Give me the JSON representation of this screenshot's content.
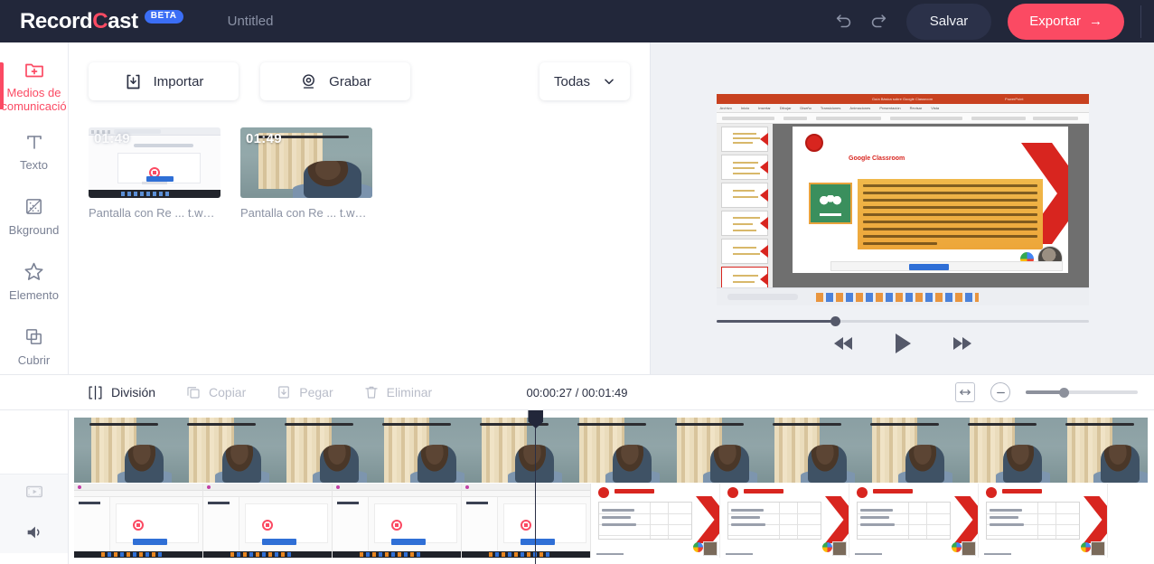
{
  "header": {
    "logo_text_pre": "Record",
    "logo_text_c": "C",
    "logo_text_post": "ast",
    "beta_label": "BETA",
    "document_title": "Untitled",
    "undo_icon": "undo-icon",
    "redo_icon": "redo-icon",
    "save_label": "Salvar",
    "export_label": "Exportar",
    "export_arrow": "→",
    "accent_color": "#fb4a63",
    "bar_color": "#22273a",
    "beta_color": "#3b6ef5"
  },
  "sidebar": {
    "items": [
      {
        "label": "Medios de comunicació",
        "icon": "folder-plus-icon",
        "active": true
      },
      {
        "label": "Texto",
        "icon": "text-t-icon",
        "active": false
      },
      {
        "label": "Bkground",
        "icon": "background-image-icon",
        "active": false
      },
      {
        "label": "Elemento",
        "icon": "star-icon",
        "active": false
      },
      {
        "label": "Cubrir",
        "icon": "overlay-layers-icon",
        "active": false
      }
    ]
  },
  "media_panel": {
    "import_label": "Importar",
    "import_icon": "download-box-icon",
    "record_label": "Grabar",
    "record_icon": "webcam-icon",
    "filter_label": "Todas",
    "filter_icon": "chevron-down-icon",
    "items": [
      {
        "duration": "01:49",
        "name": "Pantalla con Re ... t.webm",
        "kind": "screen"
      },
      {
        "duration": "01:49",
        "name": "Pantalla con Re ... t.webm",
        "kind": "camera"
      }
    ]
  },
  "preview": {
    "progress_percent": 32,
    "rewind_icon": "rewind-icon",
    "play_icon": "play-icon",
    "forward_icon": "fast-forward-icon",
    "slide": {
      "window_title": "Guía Básica sobre Google Classroom",
      "app_name": "PowerPoint",
      "ribbon_tabs": [
        "Archivo",
        "Inicio",
        "Insertar",
        "Dibujar",
        "Diseño",
        "Transiciones",
        "Animaciones",
        "Presentación con diapositivas",
        "Revisar",
        "Vista"
      ],
      "heading": "Google Classroom",
      "body": "Classroom es un servicio gratuito para escuelas, organizaciones sin fines de lucro y cualquier persona que tenga una cuenta personal de Google. Classroom permite que estudiantes y profesores se conecten fácilmente, tanto dentro como fuera de las escuelas. Classroom ahorra tiempo y papel, y facilita la creación de clases, la distribución de tareas, la comunicación y la organización.",
      "button_label": "Dejar de compartir"
    }
  },
  "timeline": {
    "actions": [
      {
        "label": "División",
        "icon": "split-icon",
        "enabled": true
      },
      {
        "label": "Copiar",
        "icon": "copy-icon",
        "enabled": false
      },
      {
        "label": "Pegar",
        "icon": "paste-icon",
        "enabled": false
      },
      {
        "label": "Eliminar",
        "icon": "trash-icon",
        "enabled": false
      }
    ],
    "current_time": "00:00:27",
    "total_time": "00:01:49",
    "time_display": "00:00:27 / 00:01:49",
    "fit_icon": "fit-to-width-icon",
    "zoom_out_icon": "zoom-minus-icon",
    "zoom_percent": 34,
    "playhead_percent": 43,
    "track_icons": {
      "video": "video-track-icon",
      "audio": "speaker-icon"
    },
    "tracks": [
      {
        "name": "camera-track",
        "frames": 11
      },
      {
        "name": "screen-track",
        "frames": 8
      }
    ]
  }
}
